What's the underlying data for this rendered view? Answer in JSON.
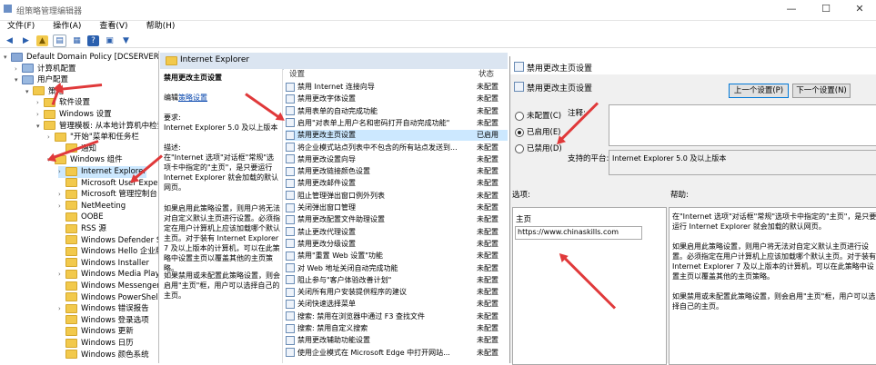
{
  "window": {
    "title": "组策略管理编辑器",
    "min": "—",
    "max": "☐",
    "close": "✕"
  },
  "menu": [
    "文件(F)",
    "操作(A)",
    "查看(V)",
    "帮助(H)"
  ],
  "toolbar": [
    "back-icon",
    "forward-icon",
    "folder-up-icon",
    "show-hide-tree-icon",
    "export-icon",
    "help-icon",
    "properties-icon",
    "filter-icon"
  ],
  "tree": [
    {
      "label": "Default Domain Policy [DCSERVER.CHI",
      "indent": 0,
      "exp": "▾"
    },
    {
      "label": "计算机配置",
      "indent": 1,
      "exp": "›"
    },
    {
      "label": "用户配置",
      "indent": 1,
      "exp": "▾"
    },
    {
      "label": "策略",
      "indent": 2,
      "exp": "▾"
    },
    {
      "label": "软件设置",
      "indent": 3,
      "exp": "›"
    },
    {
      "label": "Windows 设置",
      "indent": 3,
      "exp": "›"
    },
    {
      "label": "管理模板: 从本地计算机中检索",
      "indent": 3,
      "exp": "▾"
    },
    {
      "label": "\"开始\"菜单和任务栏",
      "indent": 4,
      "exp": "›"
    },
    {
      "label": "通知",
      "indent": 5,
      "exp": ""
    },
    {
      "label": "Windows 组件",
      "indent": 4,
      "exp": "▾"
    },
    {
      "label": "Internet Explorer",
      "indent": 5,
      "exp": "›",
      "selected": true
    },
    {
      "label": "Microsoft User Exper",
      "indent": 5,
      "exp": ""
    },
    {
      "label": "Microsoft 管理控制台",
      "indent": 5,
      "exp": "›"
    },
    {
      "label": "NetMeeting",
      "indent": 5,
      "exp": "›"
    },
    {
      "label": "OOBE",
      "indent": 5,
      "exp": ""
    },
    {
      "label": "RSS 源",
      "indent": 5,
      "exp": ""
    },
    {
      "label": "Windows Defender Sr",
      "indent": 5,
      "exp": ""
    },
    {
      "label": "Windows Hello 企业版",
      "indent": 5,
      "exp": ""
    },
    {
      "label": "Windows Installer",
      "indent": 5,
      "exp": ""
    },
    {
      "label": "Windows Media Playe",
      "indent": 5,
      "exp": "›"
    },
    {
      "label": "Windows Messenger",
      "indent": 5,
      "exp": ""
    },
    {
      "label": "Windows PowerShell",
      "indent": 5,
      "exp": ""
    },
    {
      "label": "Windows 错误报告",
      "indent": 5,
      "exp": "›"
    },
    {
      "label": "Windows 登录选项",
      "indent": 5,
      "exp": ""
    },
    {
      "label": "Windows 更新",
      "indent": 5,
      "exp": ""
    },
    {
      "label": "Windows 日历",
      "indent": 5,
      "exp": ""
    },
    {
      "label": "Windows 颜色系统",
      "indent": 5,
      "exp": ""
    }
  ],
  "middle": {
    "header": "Internet Explorer",
    "desc_title": "禁用更改主页设置",
    "edit_prefix": "编辑",
    "edit_link": "策略设置",
    "req_label": "要求:",
    "req_text": "Internet Explorer 5.0 及以上版本",
    "desc_label": "描述:",
    "desc_text1": "在\"Internet 选项\"对话框\"常规\"选项卡中指定的\"主页\"，是只要运行 Internet Explorer 就会加载的默认网页。",
    "desc_text2": "如果启用此策略设置，则用户将无法对自定义默认主页进行设置。必须指定在用户计算机上应该加载哪个默认主页。对于装有 Internet Explorer 7 及以上版本的计算机，可以在此策略中设置主页以覆盖其他的主页策略。",
    "desc_text3": "如果禁用或未配置此策略设置，则会启用\"主页\"框，用户可以选择自己的主页。",
    "col_setting": "设置",
    "col_state": "状态"
  },
  "settings": [
    {
      "name": "禁用 Internet 连接向导",
      "state": "未配置"
    },
    {
      "name": "禁用更改字体设置",
      "state": "未配置"
    },
    {
      "name": "禁用表单的自动完成功能",
      "state": "未配置"
    },
    {
      "name": "启用\"对表单上用户名和密码打开自动完成功能\"",
      "state": "未配置"
    },
    {
      "name": "禁用更改主页设置",
      "state": "已启用",
      "selected": true
    },
    {
      "name": "将企业模式站点列表中不包含的所有站点发送到...",
      "state": "未配置"
    },
    {
      "name": "禁用更改设置向导",
      "state": "未配置"
    },
    {
      "name": "禁用更改链接颜色设置",
      "state": "未配置"
    },
    {
      "name": "禁用更改邮件设置",
      "state": "未配置"
    },
    {
      "name": "阻止管理弹出窗口例外列表",
      "state": "未配置"
    },
    {
      "name": "关闭弹出窗口管理",
      "state": "未配置"
    },
    {
      "name": "禁用更改配置文件助理设置",
      "state": "未配置"
    },
    {
      "name": "禁止更改代理设置",
      "state": "未配置"
    },
    {
      "name": "禁用更改分级设置",
      "state": "未配置"
    },
    {
      "name": "禁用\"重置 Web 设置\"功能",
      "state": "未配置"
    },
    {
      "name": "对 Web 地址关闭自动完成功能",
      "state": "未配置"
    },
    {
      "name": "阻止参与\"客户体验改善计划\"",
      "state": "未配置"
    },
    {
      "name": "关闭所有用户安装提供程序的建议",
      "state": "未配置"
    },
    {
      "name": "关闭快速选择菜单",
      "state": "未配置"
    },
    {
      "name": "搜索: 禁用在浏览器中通过 F3 查找文件",
      "state": "未配置"
    },
    {
      "name": "搜索: 禁用自定义搜索",
      "state": "未配置"
    },
    {
      "name": "禁用更改辅助功能设置",
      "state": "未配置"
    },
    {
      "name": "使用企业模式在 Microsoft Edge 中打开网站...",
      "state": "未配置"
    }
  ],
  "dialog": {
    "title": "禁用更改主页设置",
    "heading": "禁用更改主页设置",
    "prev": "上一个设置(P)",
    "next": "下一个设置(N)",
    "opt_none": "未配置(C)",
    "opt_enabled": "已启用(E)",
    "opt_disabled": "已禁用(D)",
    "comment_label": "注释:",
    "platform_label": "支持的平台:",
    "platform_value": "Internet Explorer 5.0 及以上版本",
    "options_label": "选项:",
    "help_label": "帮助:",
    "homepage_label": "主页",
    "homepage_value": "https://www.chinaskills.com",
    "help_p1": "在\"Internet 选项\"对话框\"常规\"选项卡中指定的\"主页\"，是只要运行 Internet Explorer 就会加载的默认网页。",
    "help_p2": "如果启用此策略设置，则用户将无法对自定义默认主页进行设置。必须指定在用户计算机上应该加载哪个默认主页。对于装有 Internet Explorer 7 及以上版本的计算机，可以在此策略中设置主页以覆盖其他的主页策略。",
    "help_p3": "如果禁用或未配置此策略设置，则会启用\"主页\"框，用户可以选择自己的主页。",
    "selected": "enabled"
  },
  "colors": {
    "accent": "#e0393a",
    "selection": "#cce8ff",
    "header": "#dbe5f1"
  }
}
